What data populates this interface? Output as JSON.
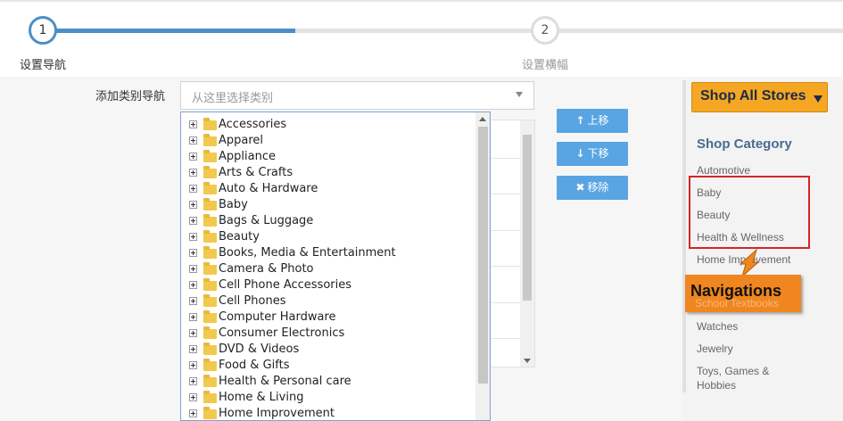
{
  "stepper": {
    "step1": {
      "number": "1",
      "label": "设置导航"
    },
    "step2": {
      "number": "2",
      "label": "设置横幅"
    }
  },
  "form": {
    "nav_label": "添加类别导航",
    "select_placeholder": "从这里选择类别"
  },
  "tree": {
    "items": [
      "Accessories",
      "Apparel",
      "Appliance",
      "Arts & Crafts",
      "Auto & Hardware",
      "Baby",
      "Bags & Luggage",
      "Beauty",
      "Books, Media & Entertainment",
      "Camera & Photo",
      "Cell Phone Accessories",
      "Cell Phones",
      "Computer Hardware",
      "Consumer Electronics",
      "DVD & Videos",
      "Food & Gifts",
      "Health & Personal care",
      "Home & Living",
      "Home Improvement"
    ]
  },
  "buttons": {
    "move_up": "上移",
    "move_down": "下移",
    "remove": "移除"
  },
  "preview": {
    "shop_all": "Shop All Stores",
    "category_title": "Shop Category",
    "categories": [
      "Automotive",
      "Baby",
      "Beauty",
      "Health & Wellness",
      "Home Improvement",
      "School Textbooks",
      "Watches",
      "Jewelry",
      "Toys, Games &",
      "Hobbies"
    ],
    "badge": "Navigations"
  },
  "colors": {
    "accent": "#4d8fc4",
    "button": "#59a5e3",
    "badge": "#f0861f",
    "highlight_box": "#d42424"
  }
}
